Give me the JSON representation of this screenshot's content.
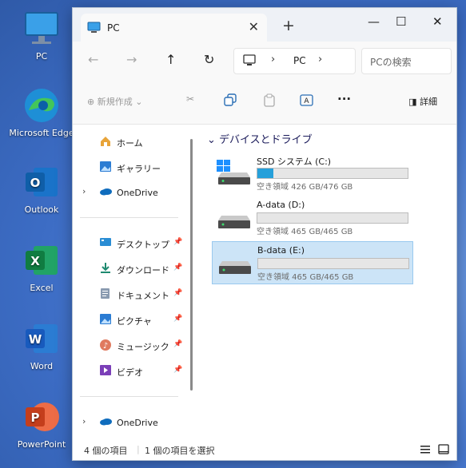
{
  "desktop": {
    "icons": [
      {
        "label": "PC",
        "icon": "monitor-icon"
      },
      {
        "label": "Microsoft Edge",
        "icon": "edge-icon"
      },
      {
        "label": "Outlook",
        "icon": "outlook-icon"
      },
      {
        "label": "Excel",
        "icon": "excel-icon"
      },
      {
        "label": "Word",
        "icon": "word-icon"
      },
      {
        "label": "PowerPoint",
        "icon": "powerpoint-icon"
      }
    ]
  },
  "window": {
    "tab_title": "PC",
    "address": {
      "crumb": "PC"
    },
    "search": {
      "placeholder": "PCの検索"
    }
  },
  "toolbar": {
    "new_label": "新規作成",
    "details_label": "詳細"
  },
  "sidebar": {
    "items": [
      {
        "label": "ホーム",
        "icon": "home-icon"
      },
      {
        "label": "ギャラリー",
        "icon": "gallery-icon"
      },
      {
        "label": "OneDrive",
        "icon": "cloud-icon"
      },
      {
        "label": "デスクトップ",
        "icon": "desktop-icon"
      },
      {
        "label": "ダウンロード",
        "icon": "download-icon"
      },
      {
        "label": "ドキュメント",
        "icon": "document-icon"
      },
      {
        "label": "ピクチャ",
        "icon": "picture-icon"
      },
      {
        "label": "ミュージック",
        "icon": "music-icon"
      },
      {
        "label": "ビデオ",
        "icon": "video-icon"
      },
      {
        "label": "OneDrive",
        "icon": "cloud-icon"
      }
    ]
  },
  "content": {
    "section_title": "デバイスとドライブ",
    "drives": [
      {
        "name": "SSD システム (C:)",
        "free_text": "空き領域 426 GB/476 GB",
        "used_fraction": 0.105
      },
      {
        "name": "A-data (D:)",
        "free_text": "空き領域 465 GB/465 GB",
        "used_fraction": 0.0
      },
      {
        "name": "B-data (E:)",
        "free_text": "空き領域 465 GB/465 GB",
        "used_fraction": 0.0
      }
    ]
  },
  "status": {
    "item_count": "4 個の項目",
    "selected": "1 個の項目を選択"
  },
  "colors": {
    "accent": "#26a0da",
    "selection": "#cce4f7"
  }
}
